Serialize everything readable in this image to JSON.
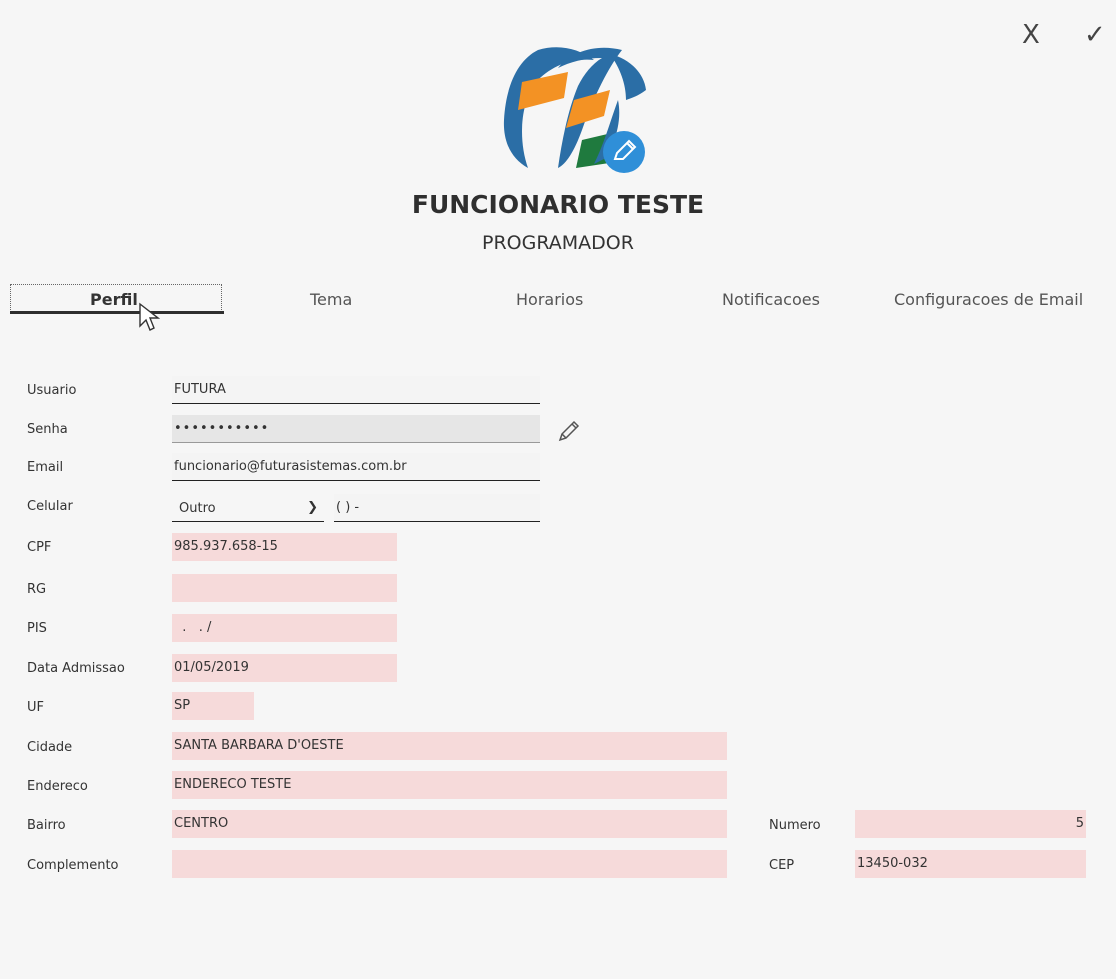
{
  "actions": {
    "close": "X",
    "confirm": "✓"
  },
  "profile": {
    "name": "FUNCIONARIO TESTE",
    "role": "PROGRAMADOR"
  },
  "tabs": [
    "Perfil",
    "Tema",
    "Horarios",
    "Notificacoes",
    "Configuracoes de Email"
  ],
  "active_tab": "Perfil",
  "form": {
    "usuario": {
      "label": "Usuario",
      "value": "FUTURA"
    },
    "senha": {
      "label": "Senha",
      "value": "•••••••••••"
    },
    "email": {
      "label": "Email",
      "value": "funcionario@futurasistemas.com.br"
    },
    "celular": {
      "label": "Celular",
      "type": "Outro",
      "number": "(  )   -"
    },
    "cpf": {
      "label": "CPF",
      "value": "985.937.658-15"
    },
    "rg": {
      "label": "RG",
      "value": ""
    },
    "pis": {
      "label": "PIS",
      "value": "  .   . /"
    },
    "data_admissao": {
      "label": "Data Admissao",
      "value": "01/05/2019"
    },
    "uf": {
      "label": "UF",
      "value": "SP"
    },
    "cidade": {
      "label": "Cidade",
      "value": "SANTA BARBARA D'OESTE"
    },
    "endereco": {
      "label": "Endereco",
      "value": "ENDERECO TESTE"
    },
    "bairro": {
      "label": "Bairro",
      "value": "CENTRO"
    },
    "numero": {
      "label": "Numero",
      "value": "5"
    },
    "complemento": {
      "label": "Complemento",
      "value": ""
    },
    "cep": {
      "label": "CEP",
      "value": "13450-032"
    }
  },
  "colors": {
    "required_field": "#f6dada",
    "logo_blue": "#2b6ea6",
    "logo_orange": "#f39224",
    "logo_green": "#1f7a3e",
    "edit_badge": "#2f8fd8"
  },
  "icons": {
    "avatar_edit": "pencil-icon",
    "password_edit": "pencil-icon",
    "select": "chevron-down-icon"
  }
}
